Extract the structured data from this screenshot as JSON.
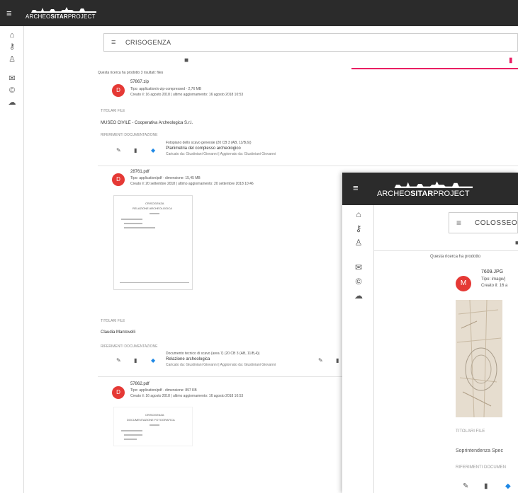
{
  "app": {
    "menu_icon": "≡",
    "logo_prefix": "ARCHEO",
    "logo_bold": "SITAR",
    "logo_suffix": "PROJECT"
  },
  "sidebar": {
    "items": [
      {
        "name": "home-icon",
        "glyph": "⌂"
      },
      {
        "name": "key-icon",
        "glyph": "⚷"
      },
      {
        "name": "person-icon",
        "glyph": "♙"
      },
      {
        "name": "mail-icon",
        "glyph": "✉"
      },
      {
        "name": "copyright-icon",
        "glyph": "©"
      },
      {
        "name": "cloud-icon",
        "glyph": "☁"
      }
    ]
  },
  "search": {
    "menu_glyph": "≡",
    "query": "CRISOGENZA"
  },
  "tabs": {
    "folder_glyph": "■",
    "file_glyph": "▮"
  },
  "results_summary": "Questa ricerca ha prodotto 3 risultati: files",
  "results": [
    {
      "avatar": "D",
      "file_name": "57867.zip",
      "type_line": "Tipo: application/x-zip-compressed · 2,76 MB",
      "created_line": "Creato il: 16 agosto 2018 | ultimo aggiornamento: 16 agosto 2018 10:53",
      "owners_label": "TITOLARI FILE",
      "owner": "MUSEO CIVILE - Cooperativa Archeologica S.r.l.",
      "refs_label": "RIFERIMENTI DOCUMENTAZIONE",
      "ref_line1": "Fotopiano dello scavo generale (20 CB 3 (AB, 11/B,6))",
      "ref_line2": "Planimetria del complesso archeologico",
      "ref_line3": "Caricato da: Giustiniani Giovanni | Aggiornato da: Giustiniani Giovanni"
    },
    {
      "avatar": "D",
      "file_name": "28761.pdf",
      "type_line": "Tipo: application/pdf · dimensione: 15,45 MB",
      "created_line": "Creato il: 20 settembre 2018 | ultimo aggiornamento: 20 settembre 2018 10:46",
      "thumb_title": "CRISOGENZA",
      "thumb_sub": "RELAZIONE ARCHEOLOGICA",
      "owners_label": "TITOLARI FILE",
      "owner": "Claudia Mantovelli",
      "refs_label": "RIFERIMENTI DOCUMENTAZIONE",
      "ref_line1": "Documento tecnico di scavo (area 7) (20 CB 3 (AB, 11/B,4))",
      "ref_line2": "Relazione archeologica",
      "ref_line3": "Caricato da: Giustiniani Giovanni | Aggiornato da: Giustiniani Giovanni"
    },
    {
      "avatar": "D",
      "file_name": "57862.pdf",
      "type_line": "Tipo: application/pdf · dimensione: 897 KB",
      "created_line": "Creato il: 16 agosto 2018 | ultimo aggiornamento: 16 agosto 2018 10:53",
      "thumb_title": "CRISOGENZA",
      "thumb_sub": "DOCUMENTAZIONE FOTOGRAFICA"
    }
  ],
  "overlay": {
    "logo_prefix": "ARCHEO",
    "logo_bold": "SITAR",
    "logo_suffix": "PROJECT",
    "search_query": "COLOSSEO",
    "results_summary": "Questa ricerca ha prodotto",
    "avatar": "M",
    "file_name": "7609.JPG",
    "type_line": "Tipo: image/j",
    "created_line": "Creato il: 16 a",
    "owners_label": "TITOLARI FILE",
    "owner": "Soprintendenza Spec",
    "refs_label": "RIFERIMENTI DOCUMEN"
  },
  "colors": {
    "topbar": "#2b2b2b",
    "accent": "#e91e63",
    "avatar": "#e53935"
  }
}
